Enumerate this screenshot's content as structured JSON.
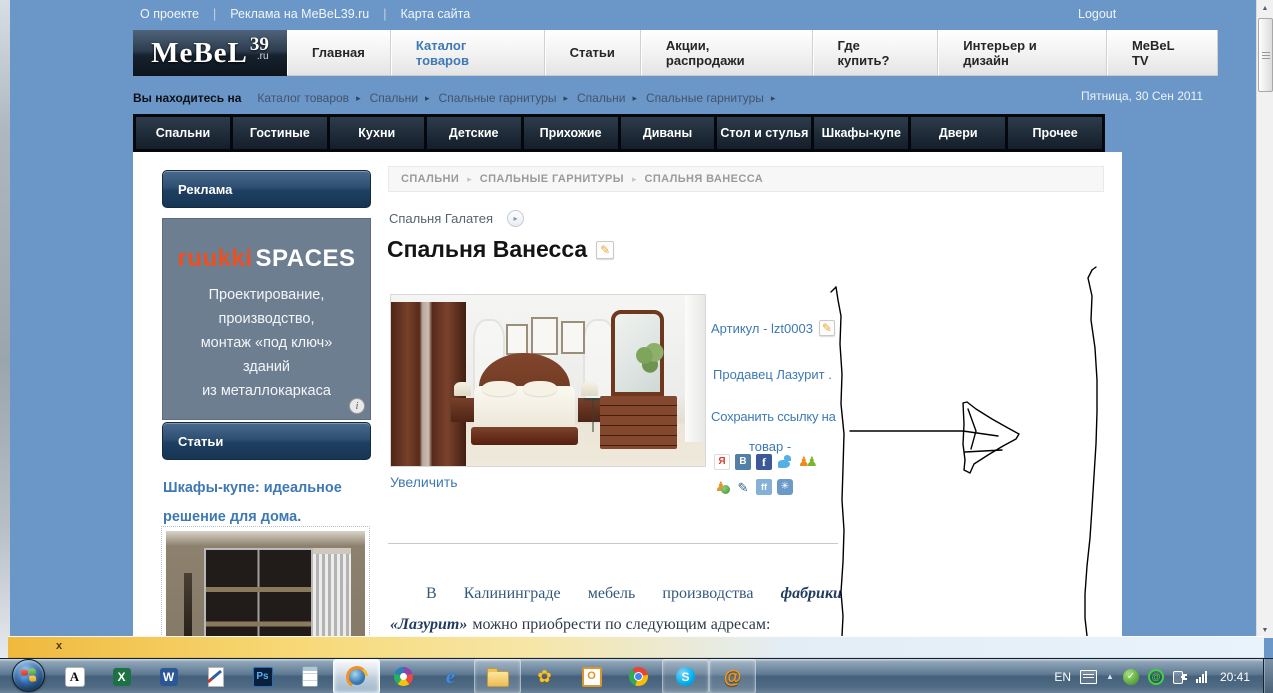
{
  "top_bar": {
    "links": [
      {
        "label": "О проекте"
      },
      {
        "label": "Реклама на MeBeL39.ru"
      },
      {
        "label": "Карта сайта"
      }
    ],
    "logout": "Logout"
  },
  "header": {
    "logo": {
      "word": "MeBeL",
      "number": "39",
      "tld": ".ru"
    },
    "nav": [
      {
        "label": "Главная"
      },
      {
        "label": "Каталог товаров",
        "state": "active"
      },
      {
        "label": "Статьи"
      },
      {
        "label": "Акции, распродажи"
      },
      {
        "label": "Где купить?"
      },
      {
        "label": "Интерьер и дизайн"
      },
      {
        "label": "MeBeL TV"
      }
    ]
  },
  "location": {
    "prefix": "Вы находитесь на",
    "crumbs": [
      {
        "label": "Каталог товаров"
      },
      {
        "label": "Спальни"
      },
      {
        "label": "Спальные гарнитуры"
      },
      {
        "label": "Спальни"
      },
      {
        "label": "Спальные гарнитуры"
      }
    ],
    "date": "Пятница, 30 Сен 2011"
  },
  "category_nav": [
    {
      "label": "Спальни"
    },
    {
      "label": "Гостиные"
    },
    {
      "label": "Кухни"
    },
    {
      "label": "Детские"
    },
    {
      "label": "Прихожие"
    },
    {
      "label": "Диваны"
    },
    {
      "label": "Стол и стулья"
    },
    {
      "label": "Шкафы-купе"
    },
    {
      "label": "Двери"
    },
    {
      "label": "Прочее"
    }
  ],
  "sidebar": {
    "ads_header": "Реклама",
    "ad": {
      "brand_left": "ruukki",
      "brand_right": "SPACES",
      "lines": [
        {
          "text": "Проектирование,"
        },
        {
          "text": "производство,"
        },
        {
          "text": "монтаж «под ключ»"
        },
        {
          "text": "зданий"
        },
        {
          "text": "из металлокаркаса"
        }
      ],
      "info_icon": "i"
    },
    "articles_header": "Статьи",
    "article": {
      "title": "Шкафы-купе: идеальное решение для дома."
    }
  },
  "product": {
    "breadcrumb": [
      {
        "label": "СПАЛЬНИ"
      },
      {
        "label": "СПАЛЬНЫЕ ГАРНИТУРЫ"
      },
      {
        "label": "СПАЛЬНЯ ВАНЕССА"
      }
    ],
    "prev_link": "Спальня Галатея",
    "title": "Спальня Ванесса",
    "zoom_link": "Увеличить",
    "sku": "Артикул - lzt0003",
    "seller": "Продавец Лазурит .",
    "save_l1": "Сохранить ссылку на",
    "save_l2": "товар -",
    "share_row1": [
      {
        "name": "yandex-bookmarks-icon",
        "cls": "si-ya",
        "glyph": "Я"
      },
      {
        "name": "vkontakte-icon",
        "cls": "si-vk",
        "glyph": "В"
      },
      {
        "name": "facebook-icon",
        "cls": "si-fb",
        "glyph": "f"
      },
      {
        "name": "twitter-icon",
        "cls": "si-tw",
        "glyph": ""
      },
      {
        "name": "bobrdobr-icon",
        "cls": "si-ppl",
        "glyph": ""
      }
    ],
    "share_row2": [
      {
        "name": "moymir-icon",
        "cls": "si-mir",
        "glyph": ""
      },
      {
        "name": "livejournal-icon",
        "cls": "si-lj",
        "glyph": "✎"
      },
      {
        "name": "friendfeed-icon",
        "cls": "si-ff",
        "glyph": "ff"
      },
      {
        "name": "liveinternet-icon",
        "cls": "si-li",
        "glyph": "✳"
      }
    ],
    "paragraph": {
      "line1_words": [
        {
          "w": "В"
        },
        {
          "w": "Калининграде"
        },
        {
          "w": "мебель"
        },
        {
          "w": "производства"
        }
      ],
      "line1_emph": "фабрики",
      "line2_emph": "«Лазурит»",
      "line2_rest": "можно приобрести по следующим адресам:"
    }
  },
  "notif_bar": {
    "close": "x"
  },
  "taskbar": {
    "icons": [
      {
        "name": "letter-a-app-icon",
        "cls": "tb-a",
        "glyph": "A"
      },
      {
        "name": "excel-icon",
        "cls": "tb-excel",
        "glyph": "X"
      },
      {
        "name": "word-icon",
        "cls": "tb-word",
        "glyph": "W"
      },
      {
        "name": "wordpad-icon",
        "cls": "tb-wordpad",
        "glyph": ""
      },
      {
        "name": "photoshop-icon",
        "cls": "tb-ps",
        "glyph": "Ps"
      },
      {
        "name": "calculator-icon",
        "cls": "tb-calc",
        "glyph": ""
      },
      {
        "name": "firefox-icon",
        "cls": "tb-ff",
        "glyph": "",
        "state": "active"
      },
      {
        "name": "picasa-icon",
        "cls": "tb-picasa",
        "glyph": ""
      },
      {
        "name": "ie-icon",
        "cls": "tb-ie",
        "glyph": "e"
      },
      {
        "name": "explorer-icon",
        "cls": "tb-folder",
        "glyph": "",
        "state": "running"
      },
      {
        "name": "icq-icon",
        "cls": "tb-icq",
        "glyph": "✿"
      },
      {
        "name": "outlook-icon",
        "cls": "tb-outlook",
        "glyph": "O"
      },
      {
        "name": "chrome-icon",
        "cls": "tb-chrome",
        "glyph": ""
      },
      {
        "name": "skype-icon",
        "cls": "tb-skype",
        "glyph": "S",
        "state": "running"
      },
      {
        "name": "mailru-agent-icon",
        "cls": "tb-mailru",
        "glyph": "@",
        "state": "running"
      }
    ],
    "tray": {
      "lang": "EN",
      "time": "20:41"
    }
  },
  "colors": {
    "page_bg": "#6b96c8",
    "accent_blue": "#3e79b4",
    "brand_orange": "#ee4f1e",
    "dark_nav": "#1d2936"
  }
}
